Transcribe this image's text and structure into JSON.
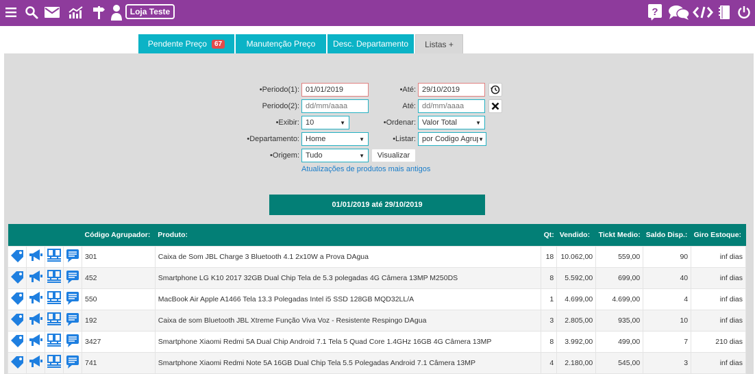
{
  "topbar": {
    "store_label": "Loja Teste",
    "color": "#8e3b9c",
    "left_icons": [
      "menu-icon",
      "search-icon",
      "mail-icon",
      "chart-icon",
      "signpost-icon",
      "user-icon"
    ],
    "right_icons": [
      "help-icon",
      "chat-icon",
      "code-icon",
      "notebook-icon",
      "power-icon"
    ]
  },
  "tabs": [
    {
      "label": "Pendente Preço",
      "badge": "67",
      "active": true
    },
    {
      "label": "Manutenção Preço",
      "active": true
    },
    {
      "label": "Desc. Departamento",
      "active": true
    },
    {
      "label": "Listas +",
      "active": false
    }
  ],
  "filters": {
    "periodo1_label": "•Periodo(1):",
    "periodo1_value": "01/01/2019",
    "ate1_label": "•Até:",
    "ate1_value": "29/10/2019",
    "periodo2_label": "Periodo(2):",
    "periodo2_placeholder": "dd/mm/aaaa",
    "ate2_label": "Até:",
    "ate2_placeholder": "dd/mm/aaaa",
    "exibir_label": "•Exibir:",
    "exibir_value": "10",
    "ordenar_label": "•Ordenar:",
    "ordenar_value": "Valor Total",
    "departamento_label": "•Departamento:",
    "departamento_value": "Home",
    "listar_label": "•Listar:",
    "listar_value": "por Codigo Agrupa",
    "origem_label": "•Origem:",
    "origem_value": "Tudo",
    "visualizar_label": "Visualizar",
    "link_label": "Atualizações de produtos mais antigos"
  },
  "range_label": "01/01/2019 até 29/10/2019",
  "table": {
    "headers": {
      "codigo": "Código Agrupador:",
      "produto": "Produto:",
      "qt": "Qt:",
      "vendido": "Vendido:",
      "ticket": "Tickt Medio:",
      "saldo": "Saldo Disp.:",
      "giro": "Giro Estoque:"
    },
    "rows": [
      {
        "codigo": "301",
        "produto": "Caixa de Som JBL Charge 3 Bluetooth 4.1 2x10W a Prova DAgua",
        "qt": "18",
        "vendido": "10.062,00",
        "ticket": "559,00",
        "saldo": "90",
        "giro": "inf dias"
      },
      {
        "codigo": "452",
        "produto": "Smartphone LG K10 2017 32GB Dual Chip Tela de 5.3 polegadas 4G Câmera 13MP M250DS",
        "qt": "8",
        "vendido": "5.592,00",
        "ticket": "699,00",
        "saldo": "40",
        "giro": "inf dias"
      },
      {
        "codigo": "550",
        "produto": "MacBook Air Apple A1466 Tela 13.3 Polegadas Intel i5 SSD 128GB MQD32LL/A",
        "qt": "1",
        "vendido": "4.699,00",
        "ticket": "4.699,00",
        "saldo": "4",
        "giro": "inf dias"
      },
      {
        "codigo": "192",
        "produto": "Caixa de som Bluetooth JBL Xtreme Função Viva Voz - Resistente Respingo DAgua",
        "qt": "3",
        "vendido": "2.805,00",
        "ticket": "935,00",
        "saldo": "10",
        "giro": "inf dias"
      },
      {
        "codigo": "3427",
        "produto": "Smartphone Xiaomi Redmi 5A Dual Chip Android 7.1 Tela 5 Quad Core 1.4GHz 16GB 4G Câmera 13MP",
        "qt": "8",
        "vendido": "3.992,00",
        "ticket": "499,00",
        "saldo": "7",
        "giro": "210 dias"
      },
      {
        "codigo": "741",
        "produto": "Smartphone Xiaomi Redmi Note 5A 16GB Dual Chip Tela 5.5 Polegadas Android 7.1 Câmera 13MP",
        "qt": "4",
        "vendido": "2.180,00",
        "ticket": "545,00",
        "saldo": "3",
        "giro": "inf dias"
      }
    ]
  },
  "row_icons": [
    "tag-icon",
    "megaphone-icon",
    "compare-icon",
    "comment-icon"
  ],
  "colors": {
    "accent": "#0bb3c6",
    "teal": "#037f76",
    "icon_blue": "#1e7fe0",
    "badge_red": "#e24b4b"
  }
}
